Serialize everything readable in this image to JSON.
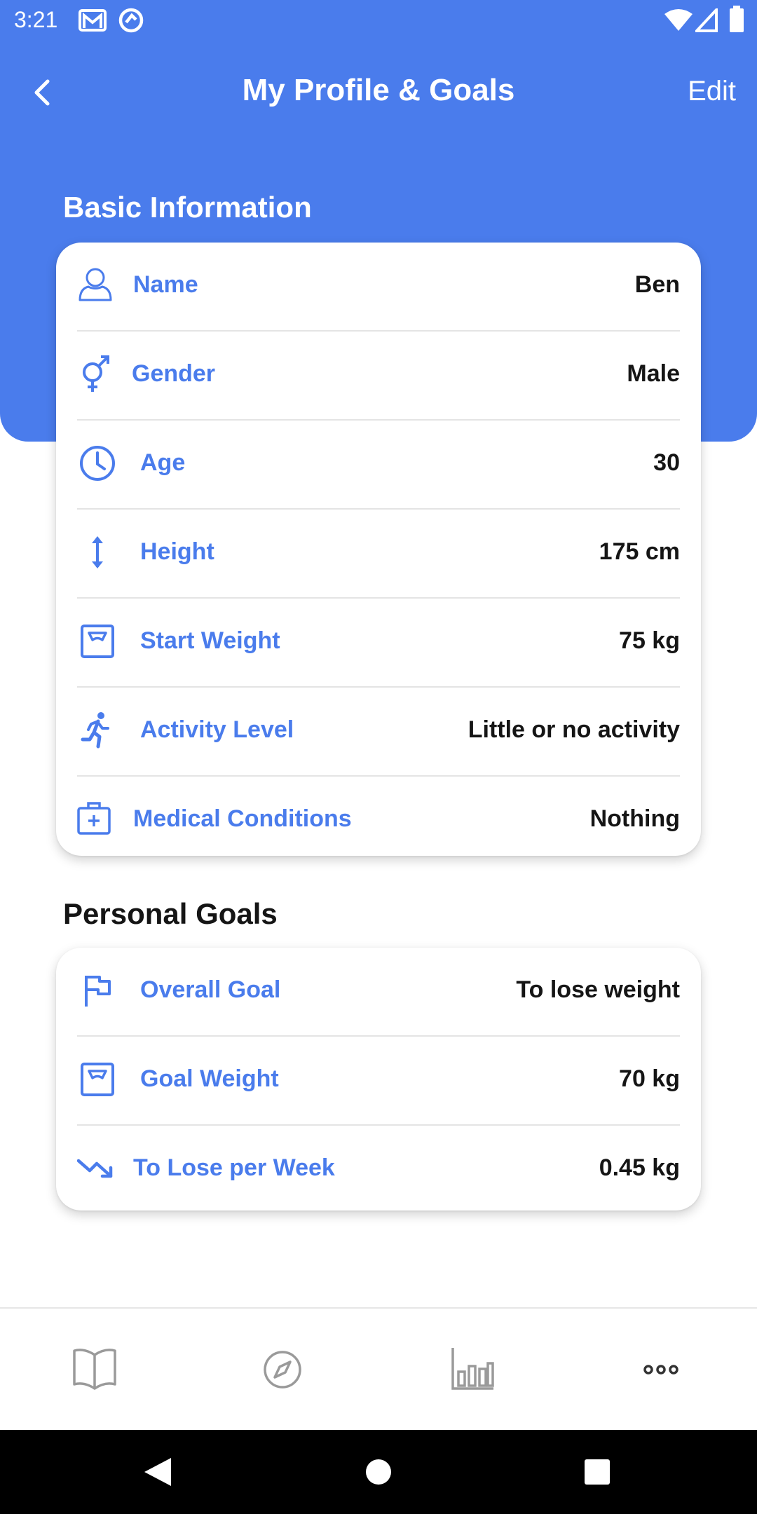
{
  "status_bar": {
    "time": "3:21",
    "icons": [
      "gmail-icon",
      "at-sign-icon",
      "wifi-icon",
      "cell-signal-icon",
      "battery-icon"
    ]
  },
  "header": {
    "back_icon": "chevron-left-icon",
    "title": "My Profile & Goals",
    "edit_label": "Edit",
    "background_color": "#4a7cec"
  },
  "basic_info": {
    "title": "Basic Information",
    "rows": [
      {
        "icon": "user-icon",
        "label": "Name",
        "value": "Ben"
      },
      {
        "icon": "gender-icon",
        "label": "Gender",
        "value": "Male"
      },
      {
        "icon": "clock-icon",
        "label": "Age",
        "value": "30"
      },
      {
        "icon": "height-arrow-icon",
        "label": "Height",
        "value": "175 cm"
      },
      {
        "icon": "scale-icon",
        "label": "Start Weight",
        "value": "75 kg"
      },
      {
        "icon": "running-person-icon",
        "label": "Activity Level",
        "value": "Little or no activity"
      },
      {
        "icon": "medical-kit-icon",
        "label": "Medical Conditions",
        "value": "Nothing"
      }
    ]
  },
  "personal_goals": {
    "title": "Personal Goals",
    "rows": [
      {
        "icon": "flag-icon",
        "label": "Overall Goal",
        "value": "To lose weight"
      },
      {
        "icon": "scale-icon",
        "label": "Goal Weight",
        "value": "70 kg"
      },
      {
        "icon": "trending-down-icon",
        "label": "To Lose per Week",
        "value": "0.45 kg"
      }
    ]
  },
  "bottom_nav": {
    "items": [
      "book-icon",
      "compass-icon",
      "bar-chart-icon",
      "more-icon"
    ]
  },
  "system_nav": [
    "back-triangle-icon",
    "home-circle-icon",
    "recents-square-icon"
  ],
  "colors": {
    "accent": "#4a7cec",
    "text_dark": "#151515",
    "divider": "#e4e4e4",
    "nav_icon_gray": "#9a9a9a"
  }
}
